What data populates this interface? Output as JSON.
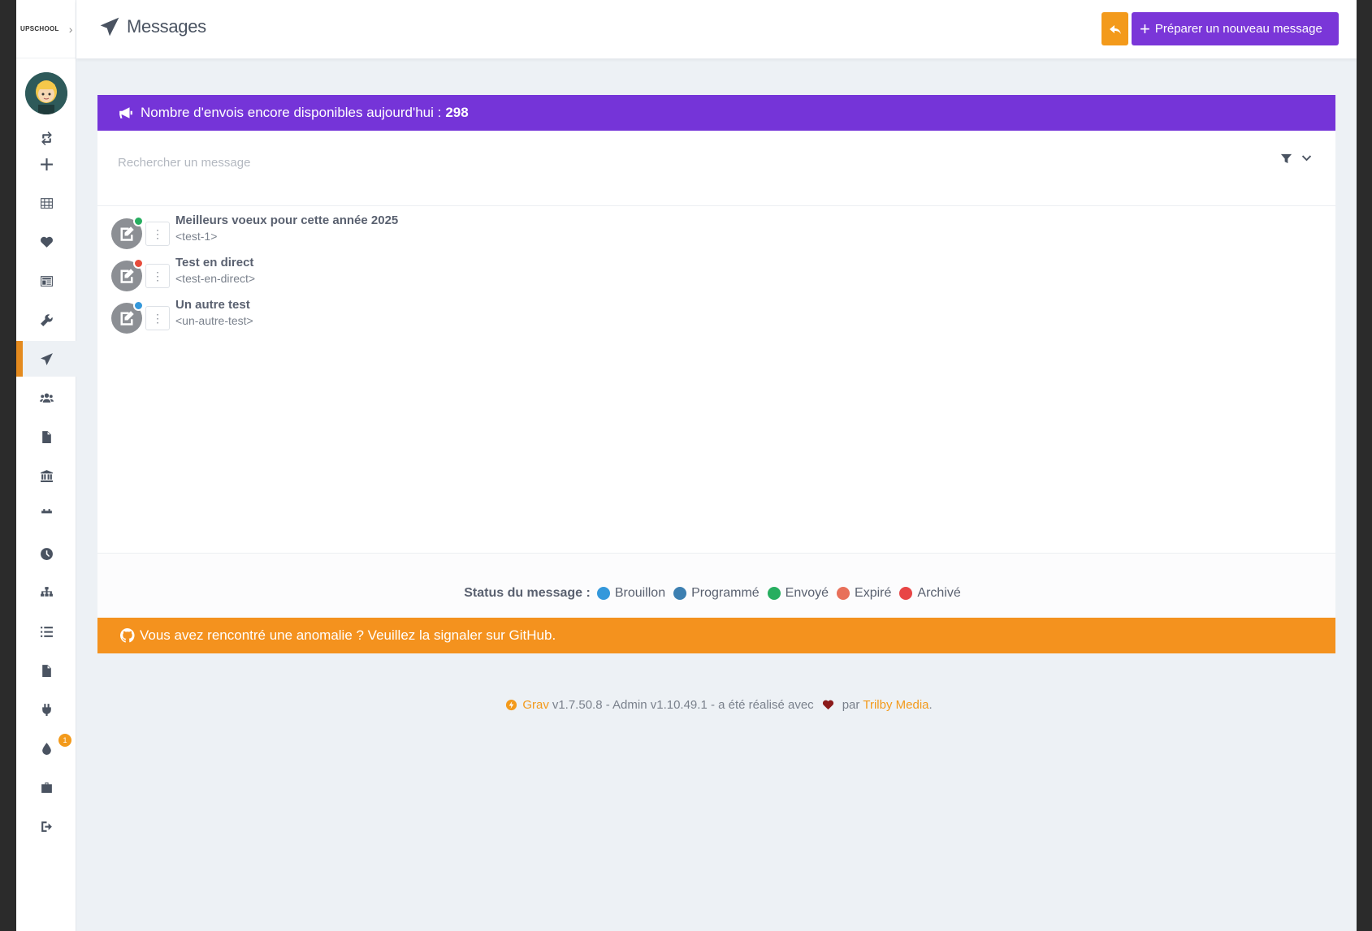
{
  "app": {
    "logo_text": "UPSCHOOL"
  },
  "header": {
    "title": "Messages",
    "new_message_label": "Préparer un nouveau message"
  },
  "banner": {
    "text": "Nombre d'envois encore disponibles aujourd'hui :",
    "count": "298"
  },
  "search": {
    "placeholder": "Rechercher un message"
  },
  "messages": [
    {
      "title": "Meilleurs voeux pour cette année 2025",
      "slug": "<test-1>",
      "status_color": "#27ae60"
    },
    {
      "title": "Test en direct",
      "slug": "<test-en-direct>",
      "status_color": "#e74c3c"
    },
    {
      "title": "Un autre test",
      "slug": "<un-autre-test>",
      "status_color": "#3498db"
    }
  ],
  "legend": {
    "label": "Status du message :",
    "items": [
      {
        "label": "Brouillon",
        "color": "#3498db"
      },
      {
        "label": "Programmé",
        "color": "#3c7fb1"
      },
      {
        "label": "Envoyé",
        "color": "#27ae60"
      },
      {
        "label": "Expiré",
        "color": "#e8705a"
      },
      {
        "label": "Archivé",
        "color": "#e84545"
      }
    ]
  },
  "warning": {
    "text": "Vous avez rencontré une anomalie ? Veuillez la signaler sur GitHub."
  },
  "footer": {
    "grav": "Grav",
    "version_text": "v1.7.50.8 - Admin v1.10.49.1 - a été réalisé avec",
    "par": "par",
    "trilby": "Trilby Media",
    "dot": "."
  },
  "sidebar": {
    "badge": "1",
    "items": [
      "sync-icon",
      "plus-icon",
      "dashboard-icon",
      "heart-icon",
      "newspaper-icon",
      "wrench-icon",
      "paper-plane-icon",
      "users-icon",
      "file-icon",
      "institution-icon",
      "calendar-icon",
      "clock-icon",
      "sitemap-icon",
      "list-icon",
      "document-icon",
      "plug-icon",
      "tint-icon",
      "briefcase-icon",
      "logout-icon"
    ]
  },
  "colors": {
    "accent_purple": "#7534d8",
    "accent_orange": "#f39a1b"
  }
}
